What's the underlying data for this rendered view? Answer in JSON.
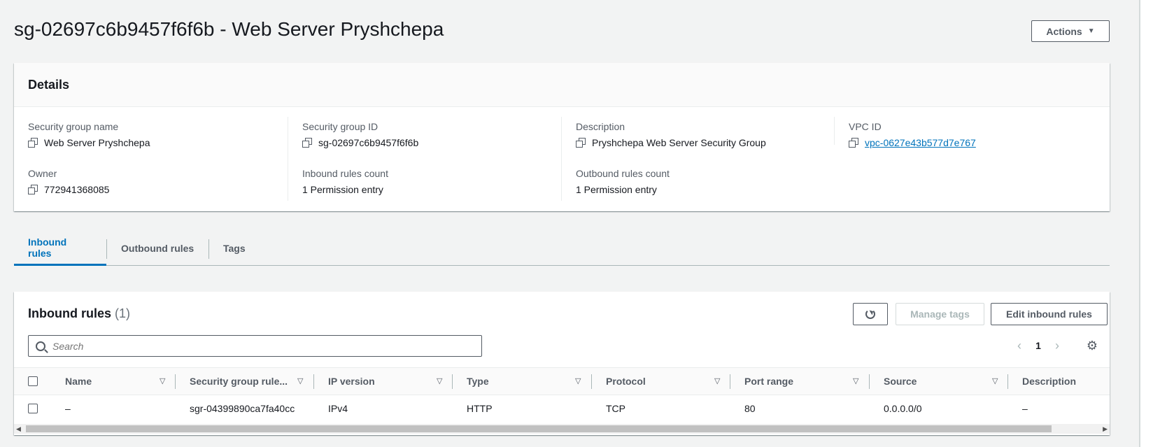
{
  "header": {
    "title": "sg-02697c6b9457f6f6b - Web Server Pryshchepa",
    "actions_label": "Actions"
  },
  "details": {
    "heading": "Details",
    "security_group_name": {
      "label": "Security group name",
      "value": "Web Server Pryshchepa"
    },
    "security_group_id": {
      "label": "Security group ID",
      "value": "sg-02697c6b9457f6f6b"
    },
    "description": {
      "label": "Description",
      "value": "Pryshchepa Web Server Security Group"
    },
    "vpc_id": {
      "label": "VPC ID",
      "value": "vpc-0627e43b577d7e767"
    },
    "owner": {
      "label": "Owner",
      "value": "772941368085"
    },
    "inbound_rules_count": {
      "label": "Inbound rules count",
      "value": "1 Permission entry"
    },
    "outbound_rules_count": {
      "label": "Outbound rules count",
      "value": "1 Permission entry"
    }
  },
  "tabs": [
    {
      "label": "Inbound rules",
      "active": true
    },
    {
      "label": "Outbound rules",
      "active": false
    },
    {
      "label": "Tags",
      "active": false
    }
  ],
  "inbound": {
    "title": "Inbound rules",
    "count": "(1)",
    "manage_tags_label": "Manage tags",
    "edit_rules_label": "Edit inbound rules",
    "search_placeholder": "Search",
    "page": "1",
    "columns": [
      "Name",
      "Security group rule...",
      "IP version",
      "Type",
      "Protocol",
      "Port range",
      "Source",
      "Description"
    ],
    "rows": [
      {
        "name": "–",
        "rule_id": "sgr-04399890ca7fa40cc",
        "ip_version": "IPv4",
        "type": "HTTP",
        "protocol": "TCP",
        "port_range": "80",
        "source": "0.0.0.0/0",
        "description": "–"
      }
    ]
  },
  "colors": {
    "accent": "#0073bb",
    "text": "#16191f",
    "muted": "#545b64",
    "background": "#f2f3f3"
  }
}
